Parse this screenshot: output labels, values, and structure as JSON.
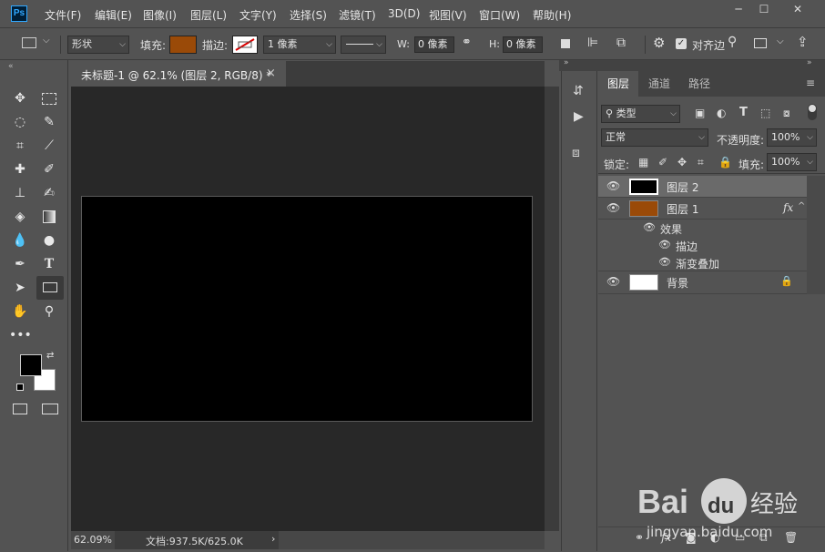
{
  "app": {
    "logo": "Ps"
  },
  "menu": [
    "文件(F)",
    "编辑(E)",
    "图像(I)",
    "图层(L)",
    "文字(Y)",
    "选择(S)",
    "滤镜(T)",
    "3D(D)",
    "视图(V)",
    "窗口(W)",
    "帮助(H)"
  ],
  "window_controls": {
    "minimize": "─",
    "restore": "☐",
    "close": "✕"
  },
  "options": {
    "shape_mode": "形状",
    "fill_label": "填充:",
    "fill_color": "#9a4a08",
    "stroke_label": "描边:",
    "stroke_width": "1 像素",
    "w_label": "W:",
    "w_value": "0 像素",
    "h_label": "H:",
    "h_value": "0 像素",
    "align_edges": "对齐边"
  },
  "document": {
    "tab_title": "未标题-1 @ 62.1% (图层 2, RGB/8) *",
    "tab_close": "×",
    "canvas_color": "#000000",
    "zoom": "62.09%",
    "doc_info": "文档:937.5K/625.0K",
    "status_arrow": "›"
  },
  "panel": {
    "tabs": [
      "图层",
      "通道",
      "路径"
    ],
    "filter_type": "类型",
    "blend_mode": "正常",
    "opacity_label": "不透明度:",
    "opacity_value": "100%",
    "lock_label": "锁定:",
    "fill_label": "填充:",
    "fill_value": "100%",
    "layers": [
      {
        "name": "图层 2",
        "thumb": "#000000",
        "selected": true
      },
      {
        "name": "图层 1",
        "thumb": "#9a4a08",
        "fx": "fx"
      },
      {
        "name": "效果",
        "sub": 1
      },
      {
        "name": "描边",
        "sub": 2
      },
      {
        "name": "渐变叠加",
        "sub": 2
      },
      {
        "name": "背景",
        "thumb": "#ffffff",
        "lock": "🔒"
      }
    ]
  },
  "watermark": {
    "brand": "Bai",
    "du": "du",
    "jingyan": "经验",
    "url": "jingyan.baidu.com"
  }
}
